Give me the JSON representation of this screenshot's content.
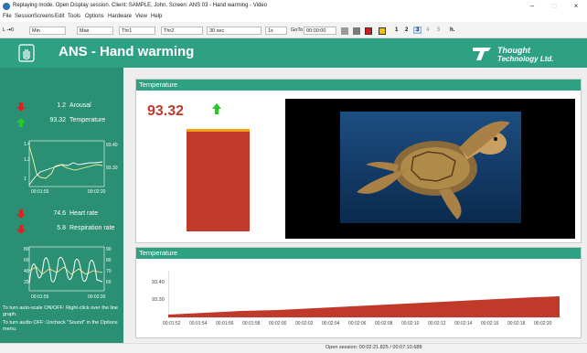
{
  "window": {
    "title": "Replaying mode. Open Display session. Client: SAMPLE, John. Screen: ANS 03 - Hand warming - Video",
    "minimize": "–",
    "maximize": "□",
    "close": "×"
  },
  "menu": [
    "File",
    "Session",
    "Screens",
    "Edit",
    "Tools",
    "Options",
    "Hardware",
    "View",
    "Help"
  ],
  "toolbar": {
    "min_prefix": "L ⇥0",
    "min_value": "Min",
    "max_value": "Max",
    "thr1_value": "Thr1",
    "thr2_value": "Thr2",
    "span_value": "30 sec",
    "speed_value": "1x",
    "goto_label": "GoTo",
    "goto_value": "00:00:00",
    "pages": [
      "1",
      "2",
      "3",
      "4",
      "5"
    ],
    "right_icon_label": "h."
  },
  "header": {
    "title": "ANS - Hand warming",
    "brand_line1": "Thought",
    "brand_line2": "Technology Ltd."
  },
  "sidebar": {
    "metrics": [
      {
        "value": "1.2",
        "label": "Arousal"
      },
      {
        "value": "93.32",
        "label": "Temperature"
      },
      {
        "value": "74.6",
        "label": "Heart rate"
      },
      {
        "value": "5.8",
        "label": "Respiration rate"
      }
    ],
    "graph1": {
      "y_ticks_left": [
        "1.4",
        "1.2",
        "1"
      ],
      "y_ticks_right": [
        "93.40",
        "93.30"
      ],
      "x_ticks": [
        "00:01:55",
        "00:02:20"
      ]
    },
    "graph2": {
      "y_ticks_left": [
        "80",
        "60",
        "40",
        "20"
      ],
      "y_ticks_right": [
        "90",
        "80",
        "70",
        "60"
      ],
      "x_ticks": [
        "00:01:55",
        "00:02:20"
      ]
    },
    "help": [
      "To turn auto-scale ON/OFF: Right-click over the line graph.",
      "To turn audio OFF: Uncheck \"Sound\" in the Options menu."
    ]
  },
  "temperature_panel": {
    "title": "Temperature",
    "value": "93.32"
  },
  "trend_panel": {
    "title": "Temperature",
    "y_ticks": [
      "93.40",
      "93.30"
    ],
    "x_ticks": [
      "00:01:52",
      "00:01:54",
      "00:01:56",
      "00:01:58",
      "00:02:00",
      "00:02:02",
      "00:02:04",
      "00:02:06",
      "00:02:08",
      "00:02:10",
      "00:02:12",
      "00:02:14",
      "00:02:16",
      "00:02:18",
      "00:02:20"
    ]
  },
  "status": {
    "text": "Open session: 00:02:21.825 / 00:07:10.688"
  },
  "colors": {
    "header": "#2fa183",
    "sidebar": "#2b8f73",
    "bar": "#c0392b",
    "up_arrow": "#22cc22",
    "down_arrow": "#e02020"
  }
}
